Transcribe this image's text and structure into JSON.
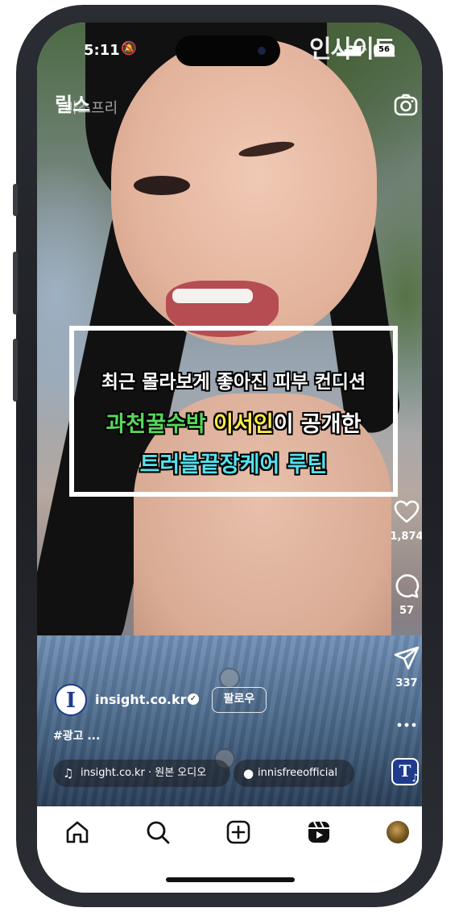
{
  "status_bar": {
    "time": "5:11",
    "battery": "56",
    "watermark": "인사이트"
  },
  "header": {
    "title": "릴스",
    "overlay_text": "마스프리"
  },
  "video_caption": {
    "line1": "최근 몰라보게 좋아진 피부 컨디션",
    "line2_part1": "과천꿀수박",
    "line2_part2": "이서인",
    "line2_part3": "이 공개한",
    "line3": "트러블끝장케어 루틴"
  },
  "colors": {
    "caption_green": "#56d85a",
    "caption_yellow": "#ffed4a",
    "caption_cyan": "#55e2ee",
    "brand_blue": "#1f3b8c"
  },
  "actions": {
    "likes": "1,874",
    "comments": "57",
    "shares": "337",
    "like_icon": "heart-icon",
    "comment_icon": "comment-icon",
    "share_icon": "send-icon",
    "more_icon": "more-icon"
  },
  "post": {
    "avatar_letter": "I",
    "username": "insight.co.kr",
    "follow_label": "팔로우",
    "caption": "#광고 ...",
    "audio": "insight.co.kr · 원본 오디오",
    "tagged_user": "innisfreeofficial",
    "audio_thumb_letter": "T"
  },
  "tabbar": {
    "items": [
      "home-icon",
      "search-icon",
      "create-icon",
      "reels-icon",
      "profile-avatar"
    ]
  }
}
